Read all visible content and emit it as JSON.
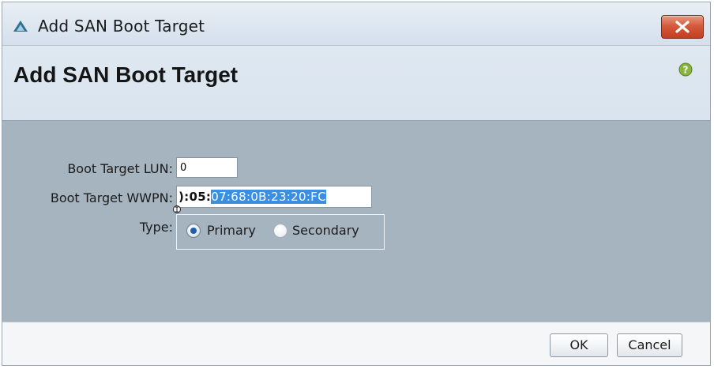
{
  "window": {
    "title": "Add SAN Boot Target",
    "close_icon": "close-icon",
    "app_icon": "ucs-manager-triangle-icon"
  },
  "header": {
    "heading": "Add SAN Boot Target",
    "help_icon": "help-icon"
  },
  "form": {
    "lun": {
      "label": "Boot Target LUN:",
      "value": "0"
    },
    "wwpn": {
      "label": "Boot Target WWPN:",
      "value_unselected": "):05:",
      "value_selected": "07:68:0B:23:20:FC"
    },
    "type": {
      "label": "Type:",
      "options": [
        {
          "label": "Primary",
          "selected": true
        },
        {
          "label": "Secondary",
          "selected": false
        }
      ]
    }
  },
  "footer": {
    "ok_label": "OK",
    "cancel_label": "Cancel"
  },
  "colors": {
    "form_background": "#a6b4c0",
    "header_background": "#dfe8f1",
    "selection_highlight": "#3a8fe0",
    "close_button": "#d45a3c"
  }
}
